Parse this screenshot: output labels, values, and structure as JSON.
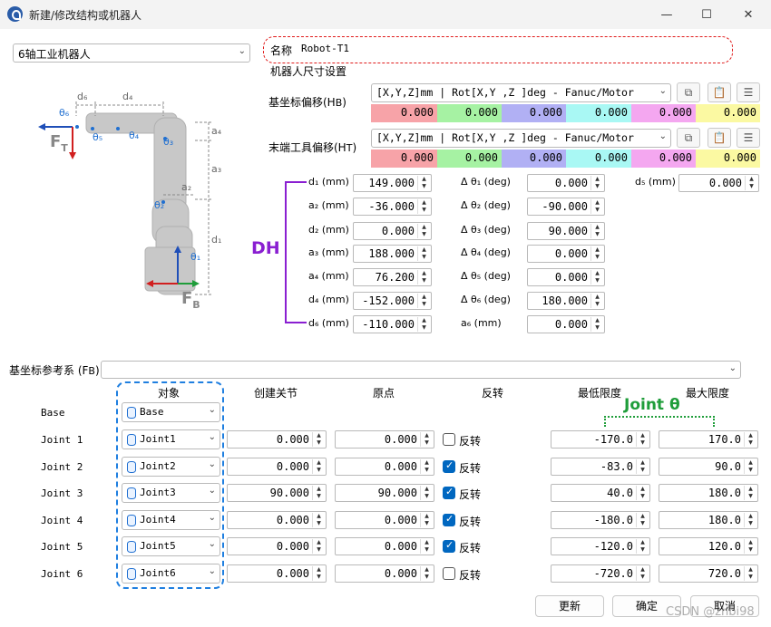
{
  "window": {
    "title": "新建/修改结构或机器人",
    "minimize": "—",
    "maximize": "☐",
    "close": "✕"
  },
  "robot_type": {
    "value": "6轴工业机器人"
  },
  "name": {
    "label": "名称",
    "value": "Robot-T1"
  },
  "size_section": {
    "title": "机器人尺寸设置"
  },
  "base_offset": {
    "label": "基坐标偏移(H",
    "sub": "B",
    "format": "[X,Y,Z]mm | Rot[X,Y ,Z  ]deg - Fanuc/Motor",
    "values": [
      "0.000",
      "0.000",
      "0.000",
      "0.000",
      "0.000",
      "0.000"
    ]
  },
  "tool_offset": {
    "label": "末端工具偏移(H",
    "sub": "T",
    "format": "[X,Y,Z]mm | Rot[X,Y ,Z  ]deg - Fanuc/Motor",
    "values": [
      "0.000",
      "0.000",
      "0.000",
      "0.000",
      "0.000",
      "0.000"
    ]
  },
  "offset_colors": [
    "#f7a3a8",
    "#a6f2a3",
    "#b1b0f4",
    "#a9f8f4",
    "#f4a7f0",
    "#fbf9a2"
  ],
  "dh": {
    "label": "DH",
    "color": "#8a1fd1",
    "col1": [
      {
        "label": "d₁ (mm)",
        "value": "149.000"
      },
      {
        "label": "a₂ (mm)",
        "value": "-36.000"
      },
      {
        "label": "d₂ (mm)",
        "value": "0.000"
      },
      {
        "label": "a₃ (mm)",
        "value": "188.000"
      },
      {
        "label": "a₄ (mm)",
        "value": "76.200"
      },
      {
        "label": "d₄ (mm)",
        "value": "-152.000"
      },
      {
        "label": "d₆ (mm)",
        "value": "-110.000"
      }
    ],
    "col2": [
      {
        "label": "Δ θ₁ (deg)",
        "value": "0.000"
      },
      {
        "label": "Δ θ₂ (deg)",
        "value": "-90.000"
      },
      {
        "label": "Δ θ₃ (deg)",
        "value": "90.000"
      },
      {
        "label": "Δ θ₄ (deg)",
        "value": "0.000"
      },
      {
        "label": "Δ θ₅ (deg)",
        "value": "0.000"
      },
      {
        "label": "Δ θ₆ (deg)",
        "value": "180.000"
      },
      {
        "label": "a₆ (mm)",
        "value": "0.000"
      }
    ],
    "col3": {
      "label": "d₅ (mm)",
      "value": "0.000"
    }
  },
  "diagram": {
    "d6": "d₆",
    "d4": "d₄",
    "a4": "a₄",
    "a3": "a₃",
    "a2": "a₂",
    "d1": "d₁",
    "theta1": "θ₁",
    "theta2": "θ₂",
    "theta3": "θ₃",
    "theta4": "θ₄",
    "theta5": "θ₅",
    "theta6": "θ₆",
    "FT": "F",
    "FT_sub": "T",
    "FB": "F",
    "FB_sub": "B"
  },
  "base_ref": {
    "label": "基坐标参考系 (F",
    "sub": "B",
    "value": ""
  },
  "joints_table": {
    "headers": {
      "object": "对象",
      "create_joint": "创建关节",
      "origin": "原点",
      "reverse": "反转",
      "min": "最低限度",
      "max": "最大限度"
    },
    "joint_theta_label": "Joint θ",
    "reverse_label": "反转",
    "rows": [
      {
        "name": "Base",
        "object": "Base"
      },
      {
        "name": "Joint 1",
        "object": "Joint1",
        "create": "0.000",
        "origin": "0.000",
        "reverse": false,
        "min": "-170.0",
        "max": "170.0"
      },
      {
        "name": "Joint 2",
        "object": "Joint2",
        "create": "0.000",
        "origin": "0.000",
        "reverse": true,
        "min": "-83.0",
        "max": "90.0"
      },
      {
        "name": "Joint 3",
        "object": "Joint3",
        "create": "90.000",
        "origin": "90.000",
        "reverse": true,
        "min": "40.0",
        "max": "180.0"
      },
      {
        "name": "Joint 4",
        "object": "Joint4",
        "create": "0.000",
        "origin": "0.000",
        "reverse": true,
        "min": "-180.0",
        "max": "180.0"
      },
      {
        "name": "Joint 5",
        "object": "Joint5",
        "create": "0.000",
        "origin": "0.000",
        "reverse": true,
        "min": "-120.0",
        "max": "120.0"
      },
      {
        "name": "Joint 6",
        "object": "Joint6",
        "create": "0.000",
        "origin": "0.000",
        "reverse": false,
        "min": "-720.0",
        "max": "720.0"
      }
    ]
  },
  "buttons": {
    "update": "更新",
    "ok": "确定",
    "cancel": "取消"
  },
  "watermark": "CSDN @zhbi98"
}
